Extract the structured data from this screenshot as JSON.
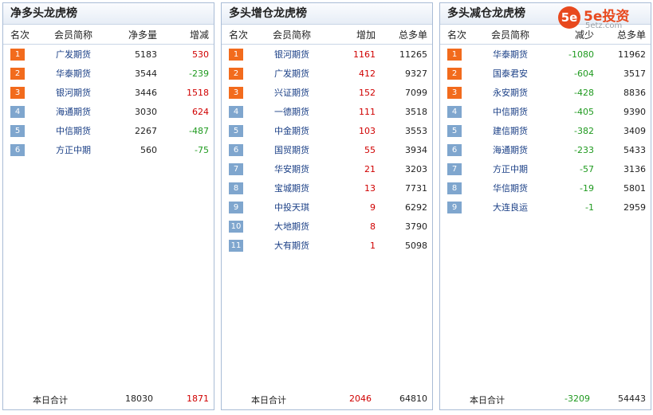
{
  "colors": {
    "rank_top": "#f26b1d",
    "rank_rest": "#7fa6ce",
    "increase": "#d00000",
    "decrease": "#1f9a1f",
    "name": "#1a3f86"
  },
  "logo": {
    "mark": "5e",
    "text": "5e投资",
    "url": "5etz.com",
    "icon": "5e-logo-icon"
  },
  "panels": [
    {
      "title": "净多头龙虎榜",
      "headers": [
        "名次",
        "会员简称",
        "净多量",
        "增减"
      ],
      "rows": [
        {
          "rank": "1",
          "name": "广发期货",
          "v1": "5183",
          "v2": "530",
          "trend": "up"
        },
        {
          "rank": "2",
          "name": "华泰期货",
          "v1": "3544",
          "v2": "-239",
          "trend": "down"
        },
        {
          "rank": "3",
          "name": "银河期货",
          "v1": "3446",
          "v2": "1518",
          "trend": "up"
        },
        {
          "rank": "4",
          "name": "海通期货",
          "v1": "3030",
          "v2": "624",
          "trend": "up"
        },
        {
          "rank": "5",
          "name": "中信期货",
          "v1": "2267",
          "v2": "-487",
          "trend": "down"
        },
        {
          "rank": "6",
          "name": "方正中期",
          "v1": "560",
          "v2": "-75",
          "trend": "down"
        }
      ],
      "footer": {
        "label": "本日合计",
        "v1": "18030",
        "v2": "1871",
        "v2_trend": "up"
      }
    },
    {
      "title": "多头增仓龙虎榜",
      "headers": [
        "名次",
        "会员简称",
        "增加",
        "总多单"
      ],
      "rows": [
        {
          "rank": "1",
          "name": "银河期货",
          "v1": "1161",
          "v2": "11265",
          "trend": "up"
        },
        {
          "rank": "2",
          "name": "广发期货",
          "v1": "412",
          "v2": "9327",
          "trend": "up"
        },
        {
          "rank": "3",
          "name": "兴证期货",
          "v1": "152",
          "v2": "7099",
          "trend": "up"
        },
        {
          "rank": "4",
          "name": "一德期货",
          "v1": "111",
          "v2": "3518",
          "trend": "up"
        },
        {
          "rank": "5",
          "name": "中金期货",
          "v1": "103",
          "v2": "3553",
          "trend": "up"
        },
        {
          "rank": "6",
          "name": "国贸期货",
          "v1": "55",
          "v2": "3934",
          "trend": "up"
        },
        {
          "rank": "7",
          "name": "华安期货",
          "v1": "21",
          "v2": "3203",
          "trend": "up"
        },
        {
          "rank": "8",
          "name": "宝城期货",
          "v1": "13",
          "v2": "7731",
          "trend": "up"
        },
        {
          "rank": "9",
          "name": "中投天琪",
          "v1": "9",
          "v2": "6292",
          "trend": "up"
        },
        {
          "rank": "10",
          "name": "大地期货",
          "v1": "8",
          "v2": "3790",
          "trend": "up"
        },
        {
          "rank": "11",
          "name": "大有期货",
          "v1": "1",
          "v2": "5098",
          "trend": "up"
        }
      ],
      "footer": {
        "label": "本日合计",
        "v1": "2046",
        "v2": "64810",
        "v1_trend": "up"
      }
    },
    {
      "title": "多头减仓龙虎榜",
      "headers": [
        "名次",
        "会员简称",
        "减少",
        "总多单"
      ],
      "rows": [
        {
          "rank": "1",
          "name": "华泰期货",
          "v1": "-1080",
          "v2": "11962",
          "trend": "down"
        },
        {
          "rank": "2",
          "name": "国泰君安",
          "v1": "-604",
          "v2": "3517",
          "trend": "down"
        },
        {
          "rank": "3",
          "name": "永安期货",
          "v1": "-428",
          "v2": "8836",
          "trend": "down"
        },
        {
          "rank": "4",
          "name": "中信期货",
          "v1": "-405",
          "v2": "9390",
          "trend": "down"
        },
        {
          "rank": "5",
          "name": "建信期货",
          "v1": "-382",
          "v2": "3409",
          "trend": "down"
        },
        {
          "rank": "6",
          "name": "海通期货",
          "v1": "-233",
          "v2": "5433",
          "trend": "down"
        },
        {
          "rank": "7",
          "name": "方正中期",
          "v1": "-57",
          "v2": "3136",
          "trend": "down"
        },
        {
          "rank": "8",
          "name": "华信期货",
          "v1": "-19",
          "v2": "5801",
          "trend": "down"
        },
        {
          "rank": "9",
          "name": "大连良运",
          "v1": "-1",
          "v2": "2959",
          "trend": "down"
        }
      ],
      "footer": {
        "label": "本日合计",
        "v1": "-3209",
        "v2": "54443",
        "v1_trend": "down"
      }
    }
  ]
}
